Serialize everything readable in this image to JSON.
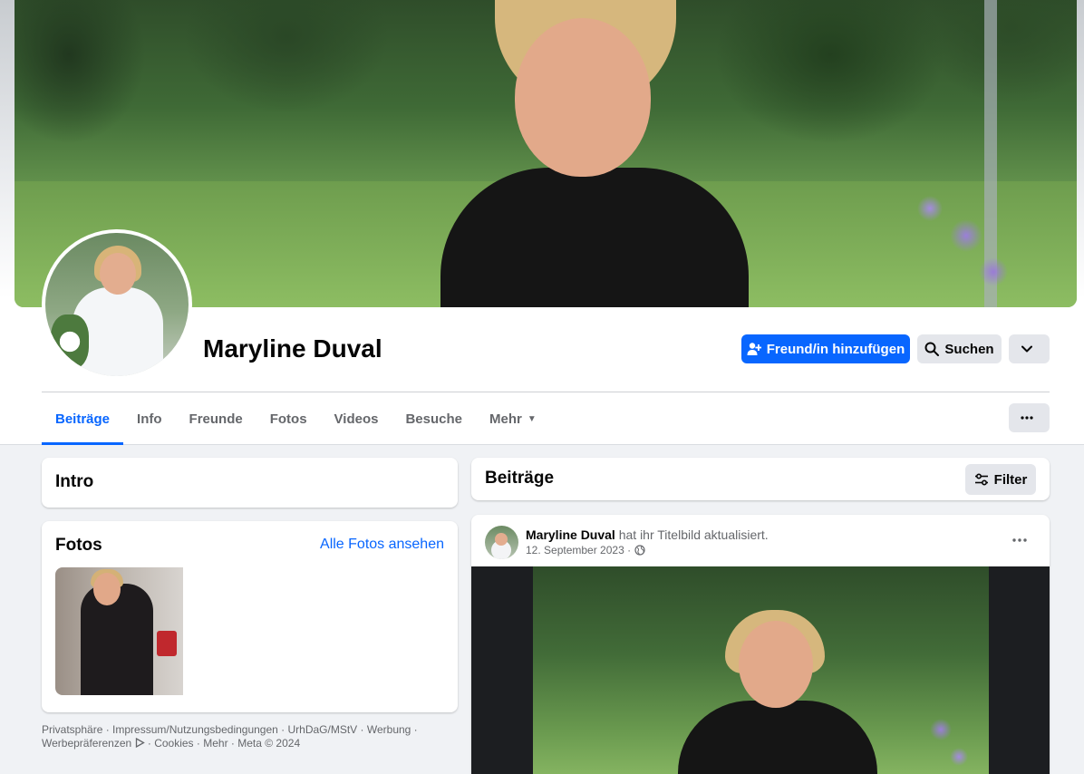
{
  "profile": {
    "name": "Maryline Duval"
  },
  "actions": {
    "add_friend_label": "Freund/in hinzufügen",
    "search_label": "Suchen"
  },
  "tabs": [
    {
      "label": "Beiträge",
      "active": true
    },
    {
      "label": "Info"
    },
    {
      "label": "Freunde"
    },
    {
      "label": "Fotos"
    },
    {
      "label": "Videos"
    },
    {
      "label": "Besuche"
    },
    {
      "label": "Mehr"
    }
  ],
  "intro": {
    "title": "Intro"
  },
  "photos": {
    "title": "Fotos",
    "see_all": "Alle Fotos ansehen"
  },
  "footer": {
    "links": [
      "Privatsphäre",
      "Impressum/Nutzungsbedingungen",
      "UrhDaG/MStV",
      "Werbung",
      "Werbepräferenzen",
      "Cookies",
      "Mehr"
    ],
    "copyright": "Meta © 2024"
  },
  "posts_section": {
    "title": "Beiträge",
    "filter_label": "Filter"
  },
  "post": {
    "author": "Maryline Duval",
    "action_text": "hat ihr Titelbild aktualisiert.",
    "date": "12. September 2023"
  },
  "colors": {
    "accent": "#0866ff",
    "background": "#f0f2f5",
    "secondary_button": "#e4e6eb",
    "muted_text": "#65676b"
  }
}
